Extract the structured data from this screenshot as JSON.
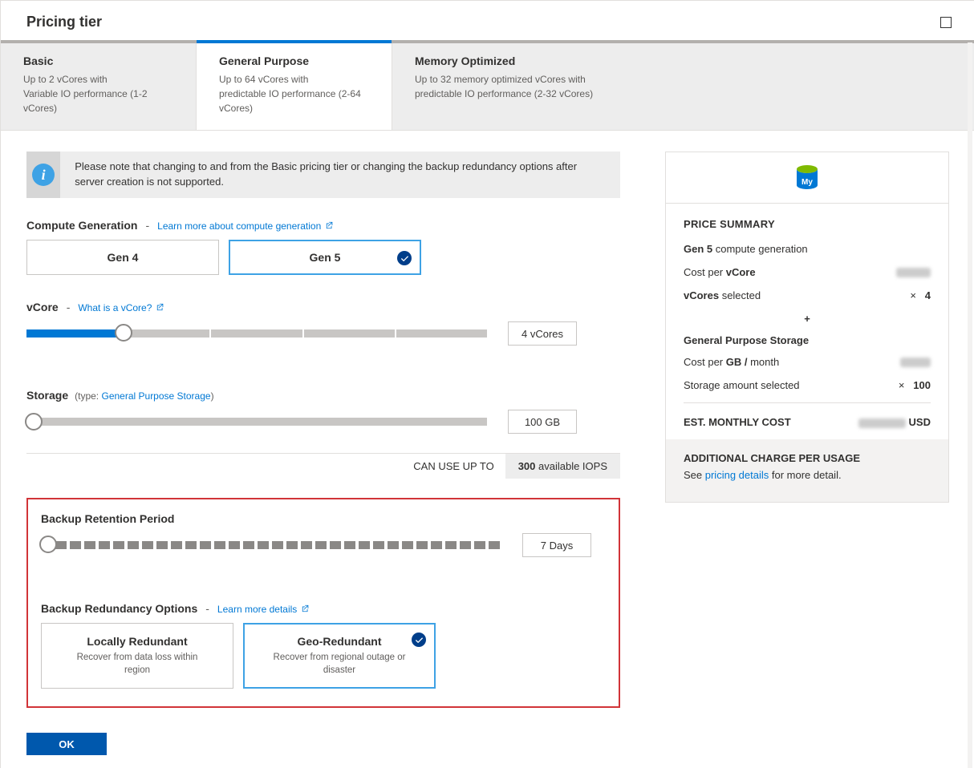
{
  "header": {
    "title": "Pricing tier"
  },
  "tabs": [
    {
      "title": "Basic",
      "line1": "Up to 2 vCores with",
      "line2": "Variable IO performance (1-2 vCores)"
    },
    {
      "title": "General Purpose",
      "line1": "Up to 64 vCores with",
      "line2": "predictable IO performance (2-64 vCores)"
    },
    {
      "title": "Memory Optimized",
      "line1": "Up to 32 memory optimized vCores with",
      "line2": "predictable IO performance (2-32 vCores)"
    }
  ],
  "active_tab": 1,
  "info_text": "Please note that changing to and from the Basic pricing tier or changing the backup redundancy options after server creation is not supported.",
  "compute": {
    "label": "Compute Generation",
    "learn": "Learn more about compute generation",
    "options": [
      "Gen 4",
      "Gen 5"
    ],
    "selected": 1
  },
  "vcore": {
    "label": "vCore",
    "learn": "What is a vCore?",
    "value_display": "4 vCores",
    "segments": 5,
    "filled_fraction": 0.21
  },
  "storage": {
    "label": "Storage",
    "type_prefix": "(type:",
    "type_link": "General Purpose Storage",
    "type_suffix": ")",
    "value_display": "100 GB",
    "fill_fraction": 0.0
  },
  "iops": {
    "label": "CAN USE UP TO",
    "value_num": "300",
    "value_txt": " available IOPS"
  },
  "backup": {
    "retention_label": "Backup Retention Period",
    "retention_value": "7 Days",
    "redundancy_label": "Backup Redundancy Options",
    "learn": "Learn more details",
    "options": [
      {
        "title": "Locally Redundant",
        "desc": "Recover from data loss within region"
      },
      {
        "title": "Geo-Redundant",
        "desc": "Recover from regional outage or disaster"
      }
    ],
    "selected": 1
  },
  "summary": {
    "title": "PRICE SUMMARY",
    "gen_line_bold": "Gen 5",
    "gen_line_rest": " compute generation",
    "cost_vcore_label_pre": "Cost per ",
    "cost_vcore_label_bold": "vCore",
    "vcores_sel_pre": "vCores",
    "vcores_sel_rest": " selected",
    "vcores_sel_val": "4",
    "section2": "General Purpose Storage",
    "cost_gb_pre": "Cost per ",
    "cost_gb_bold": "GB /",
    "cost_gb_rest": " month",
    "storage_sel": "Storage amount selected",
    "storage_val": "100",
    "est_label": "EST. MONTHLY COST",
    "est_currency": "USD",
    "footer_title": "ADDITIONAL CHARGE PER USAGE",
    "footer_pre": "See ",
    "footer_link": "pricing details",
    "footer_post": " for more detail."
  },
  "ok_label": "OK"
}
